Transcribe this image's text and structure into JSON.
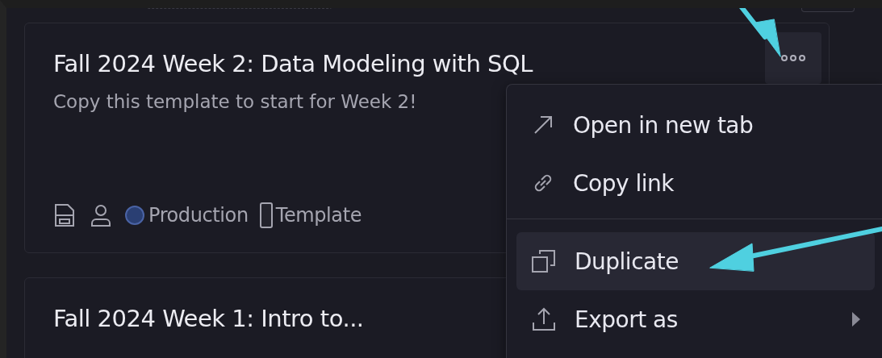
{
  "cards": [
    {
      "title": "Fall 2024 Week 2: Data Modeling with SQL",
      "description": "Copy this template to start for Week 2!",
      "status": "Production",
      "tag": "Template",
      "menu_open": true
    },
    {
      "title": "Fall 2024 Week 1: Intro to..."
    }
  ],
  "menu": {
    "groups": [
      [
        {
          "label": "Open in new tab",
          "selected": false,
          "submenu": false
        },
        {
          "label": "Copy link",
          "selected": false,
          "submenu": false
        }
      ],
      [
        {
          "label": "Duplicate",
          "selected": true,
          "submenu": false
        },
        {
          "label": "Export as",
          "selected": false,
          "submenu": true
        }
      ]
    ]
  }
}
